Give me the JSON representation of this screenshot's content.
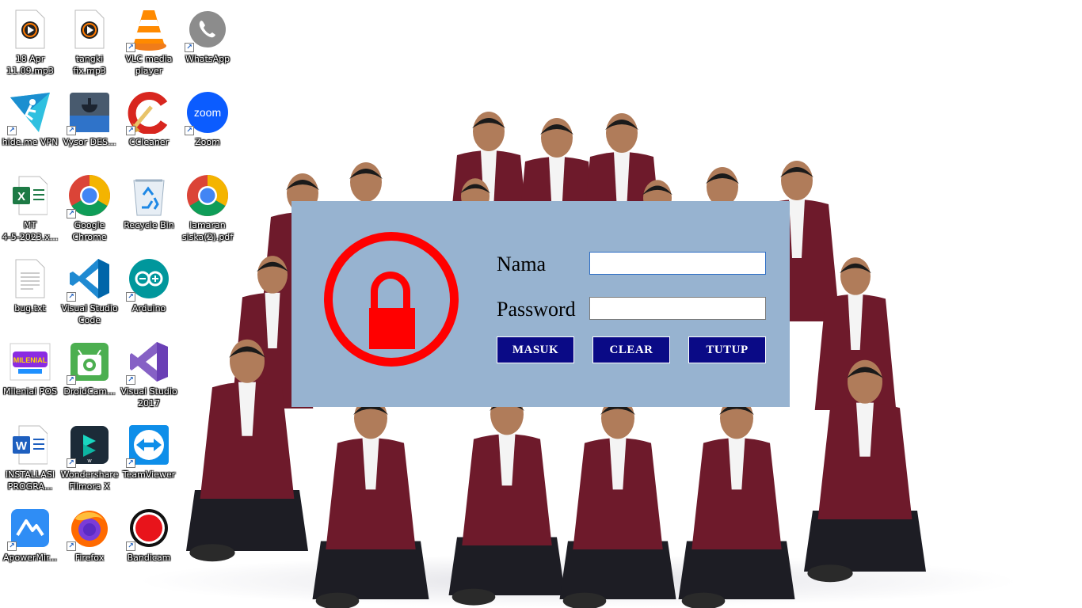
{
  "desktop": {
    "icons": [
      {
        "name": "audio-file-icon",
        "label": "18 Apr\n11.09.mp3",
        "shortcut": false
      },
      {
        "name": "audio-file-icon",
        "label": "tangki\nfix.mp3",
        "shortcut": false
      },
      {
        "name": "vlc-icon",
        "label": "VLC media\nplayer",
        "shortcut": true
      },
      {
        "name": "whatsapp-icon",
        "label": "WhatsApp",
        "shortcut": true
      },
      {
        "name": "hideme-vpn-icon",
        "label": "hide.me VPN",
        "shortcut": true
      },
      {
        "name": "vysor-icon",
        "label": "Vysor DES...",
        "shortcut": true
      },
      {
        "name": "ccleaner-icon",
        "label": "CCleaner",
        "shortcut": true
      },
      {
        "name": "zoom-icon",
        "label": "Zoom",
        "shortcut": true
      },
      {
        "name": "excel-file-icon",
        "label": "MT\n4-5-2023.x...",
        "shortcut": false
      },
      {
        "name": "chrome-icon",
        "label": "Google\nChrome",
        "shortcut": true
      },
      {
        "name": "recycle-bin-icon",
        "label": "Recycle Bin",
        "shortcut": false
      },
      {
        "name": "chrome-pdf-icon",
        "label": "lamaran\nsiska(2).pdf",
        "shortcut": false
      },
      {
        "name": "text-file-icon",
        "label": "bug.txt",
        "shortcut": false
      },
      {
        "name": "vscode-icon",
        "label": "Visual Studio\nCode",
        "shortcut": true
      },
      {
        "name": "arduino-icon",
        "label": "Arduino",
        "shortcut": true
      },
      {
        "name": "milenial-pos-icon",
        "label": "Milenial POS",
        "shortcut": false
      },
      {
        "name": "droidcam-icon",
        "label": "DroidCam...",
        "shortcut": true
      },
      {
        "name": "visual-studio-icon",
        "label": "Visual Studio\n2017",
        "shortcut": true
      },
      {
        "name": "word-file-icon",
        "label": "INSTALLASI\nPROGRA...",
        "shortcut": false
      },
      {
        "name": "filmora-icon",
        "label": "Wondershare\nFilmora X",
        "shortcut": true
      },
      {
        "name": "teamviewer-icon",
        "label": "TeamViewer",
        "shortcut": true
      },
      {
        "name": "apowermirror-icon",
        "label": "ApowerMir...",
        "shortcut": true
      },
      {
        "name": "firefox-icon",
        "label": "Firefox",
        "shortcut": true
      },
      {
        "name": "bandicam-icon",
        "label": "Bandicam",
        "shortcut": true
      }
    ]
  },
  "login": {
    "name_label": "Nama",
    "password_label": "Password",
    "name_value": "",
    "password_value": "",
    "buttons": {
      "masuk": "MASUK",
      "clear": "CLEAR",
      "tutup": "TUTUP"
    }
  },
  "colors": {
    "dialog_bg": "#97b3d0",
    "lock_red": "#ff0000",
    "button_bg": "#0a0a86",
    "jacket": "#6e1a2b"
  }
}
